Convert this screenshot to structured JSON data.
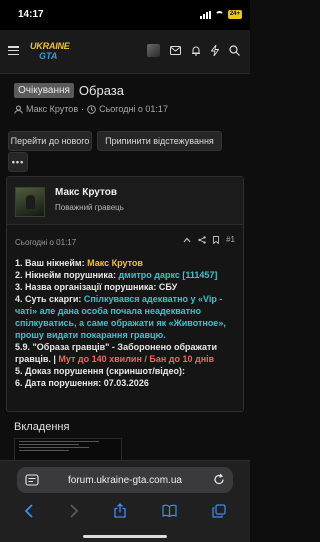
{
  "status_bar": {
    "time": "14:17",
    "battery": "24+"
  },
  "header": {
    "logo_line1": "UKRAINE",
    "logo_line2": "GTA"
  },
  "thread": {
    "prefix": "Очікування",
    "title": "Образа",
    "author": "Макс Крутов",
    "date": "Сьогодні о 01:17"
  },
  "actions": {
    "next": "Перейти до нового",
    "unwatch": "Припинити відстежування",
    "more": "•••"
  },
  "post": {
    "username": "Макс Крутов",
    "user_title": "Поважний гравець",
    "date": "Сьогодні о 01:17",
    "number": "#1",
    "line1_label": "1. Ваш нікнейм: ",
    "line1_value": "Макс Крутов",
    "line2_label": "2. Нікнейм порушника: ",
    "line2_value": "дмитро даркс [111457]",
    "line3": "3. Назва організації порушника: СБУ",
    "line4_label": "4. Суть скарги: ",
    "line4_value": "Спілкувався адекватно у «Vip - чаті» але дана особа почала неадекватно спілкуватись, а саме ображати як «Животное», прошу видати покарання гравцю.",
    "line5_label": "5.9. \"Образа гравців\" - Заборонено ображати гравців. | ",
    "line5_value": "Мут до 140 хвилин / Бан до 10 днів",
    "line6": "5. Доказ порушення (скриншот/відео):",
    "line7": "6. Дата порушення: 07.03.2026"
  },
  "attachments": {
    "title": "Вкладення"
  },
  "browser": {
    "url": "forum.ukraine-gta.com.ua"
  },
  "colors": {
    "accent_yellow": "#f2c12e",
    "accent_teal": "#3bc3c9",
    "accent_red": "#ef6464",
    "background": "#0e0e0e"
  }
}
